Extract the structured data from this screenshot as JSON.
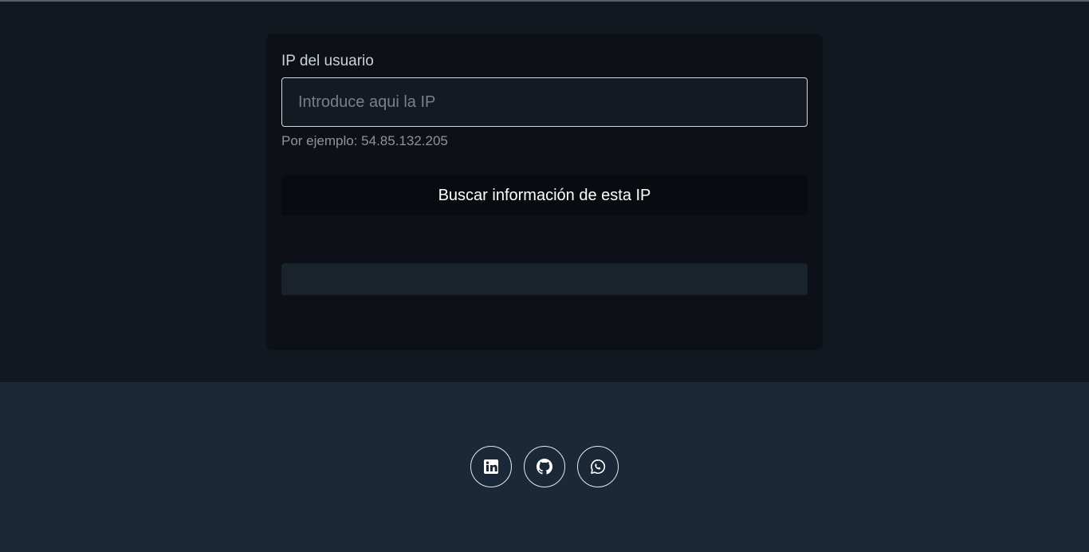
{
  "form": {
    "label": "IP del usuario",
    "input_placeholder": "Introduce aqui la IP",
    "input_value": "",
    "hint": "Por ejemplo: 54.85.132.205",
    "search_button": "Buscar información de esta IP"
  },
  "result": {
    "text": ""
  },
  "footer": {
    "social_links": [
      {
        "icon": "linkedin-icon"
      },
      {
        "icon": "github-icon"
      },
      {
        "icon": "whatsapp-icon"
      }
    ]
  },
  "colors": {
    "background": "#111820",
    "card": "#0d1117",
    "footer": "#1b2838",
    "button": "#080b0f"
  }
}
